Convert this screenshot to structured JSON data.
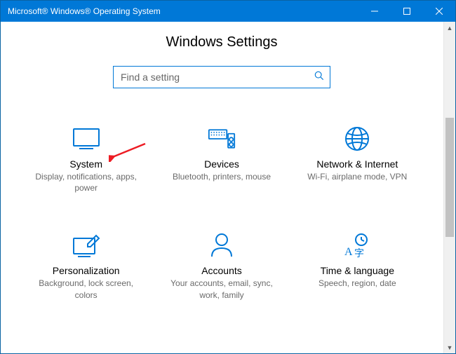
{
  "window": {
    "title": "Microsoft® Windows® Operating System"
  },
  "page": {
    "title": "Windows Settings"
  },
  "search": {
    "placeholder": "Find a setting"
  },
  "tiles": [
    {
      "title": "System",
      "desc": "Display, notifications, apps, power"
    },
    {
      "title": "Devices",
      "desc": "Bluetooth, printers, mouse"
    },
    {
      "title": "Network & Internet",
      "desc": "Wi-Fi, airplane mode, VPN"
    },
    {
      "title": "Personalization",
      "desc": "Background, lock screen, colors"
    },
    {
      "title": "Accounts",
      "desc": "Your accounts, email, sync, work, family"
    },
    {
      "title": "Time & language",
      "desc": "Speech, region, date"
    }
  ],
  "colors": {
    "accent": "#0078d7",
    "arrow": "#ed1c24"
  }
}
